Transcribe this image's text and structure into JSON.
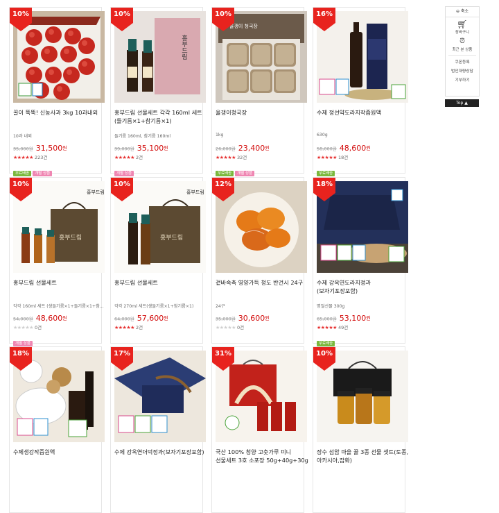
{
  "products": [
    {
      "discount": "10%",
      "name": "꿀이 뚝뚝! 신농사과 3kg 10과내외",
      "sub": "10과 내외",
      "orig": "35,000원",
      "price": "31,500",
      "won": "원",
      "stars": 5,
      "reviews": "223건",
      "tags": [
        {
          "text": "무료배송",
          "color": "green"
        },
        {
          "text": "개별 상품",
          "color": "pink"
        }
      ],
      "img": "apple"
    },
    {
      "discount": "10%",
      "name": "홍부드림 선물세트 각각 160ml 세트 (들기름×1+참기름×1)",
      "sub": "들기름 160ml, 참기름 160ml",
      "orig": "39,000원",
      "price": "35,100",
      "won": "원",
      "stars": 5,
      "reviews": "2건",
      "tags": [
        {
          "text": "개별 상품",
          "color": "pink"
        }
      ],
      "img": "oilbox"
    },
    {
      "discount": "10%",
      "name": "율갱이청국장",
      "sub": "1kg",
      "orig": "26,000원",
      "price": "23,400",
      "won": "원",
      "stars": 5,
      "reviews": "32건",
      "tags": [
        {
          "text": "무료배송",
          "color": "green"
        },
        {
          "text": "개별 상품",
          "color": "pink"
        }
      ],
      "img": "natto"
    },
    {
      "discount": "16%",
      "name": "수제 정선약도라지작즙원액",
      "sub": "630g",
      "orig": "58,000원",
      "price": "48,600",
      "won": "원",
      "stars": 5,
      "reviews": "18건",
      "tags": [
        {
          "text": "무료배송",
          "color": "green"
        }
      ],
      "img": "bottle"
    },
    {
      "discount": "10%",
      "name": "홍부드림 선물세트",
      "sub": "각각 160ml 세트 (생들기름×1+들기름×1+참...",
      "orig": "54,000원",
      "price": "48,600",
      "won": "원",
      "stars": 0,
      "reviews": "0건",
      "tags": [
        {
          "text": "개별 상품",
          "color": "pink"
        }
      ],
      "img": "bag3"
    },
    {
      "discount": "10%",
      "name": "홍부드림 선물세트",
      "sub": "각각 270ml 세트(생들기름×1+참기름×1)",
      "orig": "64,000원",
      "price": "57,600",
      "won": "원",
      "stars": 5,
      "reviews": "2건",
      "tags": [],
      "img": "bag2"
    },
    {
      "discount": "12%",
      "name": "겉바속촉 영양가득 청도 반건시 24구",
      "sub": "24구",
      "orig": "35,000원",
      "price": "30,600",
      "won": "원",
      "stars": 0,
      "reviews": "0건",
      "tags": [],
      "img": "persimmon"
    },
    {
      "discount": "18%",
      "name": "수제 강옥연도라지정과(보자기포장포함)",
      "sub": "명절선물 300g",
      "orig": "65,000원",
      "price": "53,100",
      "won": "원",
      "stars": 5,
      "reviews": "49건",
      "tags": [
        {
          "text": "무료배송",
          "color": "green"
        }
      ],
      "img": "wrap"
    },
    {
      "discount": "18%",
      "name": "수제생강작즙원액",
      "sub": "",
      "orig": "",
      "price": "",
      "won": "",
      "stars": -1,
      "reviews": "",
      "tags": [],
      "img": "ginger"
    },
    {
      "discount": "17%",
      "name": "수제 강옥연더덕정과(보자기포장포함)",
      "sub": "",
      "orig": "",
      "price": "",
      "won": "",
      "stars": -1,
      "reviews": "",
      "tags": [],
      "img": "deodeok"
    },
    {
      "discount": "31%",
      "name": "국산 100% 청양 고춧가루 미니 선물세트 3호 소포장 50g+40g+30g",
      "sub": "",
      "orig": "",
      "price": "",
      "won": "",
      "stars": -1,
      "reviews": "",
      "tags": [],
      "img": "pepper"
    },
    {
      "discount": "10%",
      "name": "장수 섬암 마을 꿀 3종 선물 셋트(토종,아카시아,잡화)",
      "sub": "",
      "orig": "",
      "price": "",
      "won": "",
      "stars": -1,
      "reviews": "",
      "tags": [],
      "img": "honey"
    }
  ],
  "sidebar": {
    "shrink_label": "축소",
    "cart_label": "장바구니",
    "recent_label": "최근 본 상품",
    "links": [
      "쿠폰등록",
      "법인대량상담",
      "기부하기"
    ],
    "top_label": "Top ▲"
  },
  "colors": {
    "badge": "#e8231e",
    "sale": "#d20a0a",
    "tag_green": "#7ab83c",
    "tag_pink": "#ef86b2"
  },
  "image_labels": {
    "oil_brand": "홍부드림",
    "natto_box": "율갱이 청국장"
  }
}
